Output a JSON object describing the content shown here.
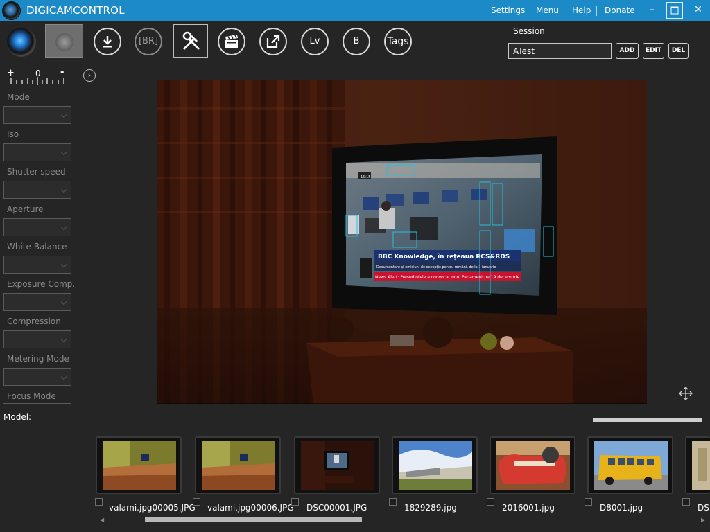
{
  "titlebar": {
    "app_title": "DIGICAMCONTROL",
    "menu": [
      "Settings",
      "Menu",
      "Help",
      "Donate"
    ],
    "min_label": "–",
    "max_label": "▢",
    "close_label": "✕"
  },
  "toolbar": {
    "br_label": "[BR]",
    "lv_label": "Lv",
    "b_label": "B",
    "tags_label": "Tags"
  },
  "session": {
    "label": "Session",
    "value": "ATest",
    "add": "ADD",
    "edit": "EDIT",
    "del": "DEL"
  },
  "left_panel": {
    "ev_plus": "+",
    "ev_zero": "0",
    "ev_minus": "-",
    "fields": [
      {
        "label": "Mode"
      },
      {
        "label": "Iso"
      },
      {
        "label": "Shutter speed"
      },
      {
        "label": "Aperture"
      },
      {
        "label": "White Balance"
      },
      {
        "label": "Exposure Comp."
      },
      {
        "label": "Compression"
      },
      {
        "label": "Metering Mode"
      },
      {
        "label": "Focus Mode"
      }
    ],
    "model_label": "Model:"
  },
  "thumbnails": [
    {
      "name": "valami.jpg00005.JPG"
    },
    {
      "name": "valami.jpg00006.JPG"
    },
    {
      "name": "DSC00001.JPG"
    },
    {
      "name": "1829289.jpg"
    },
    {
      "name": "2016001.jpg"
    },
    {
      "name": "D8001.jpg"
    },
    {
      "name": "DS"
    }
  ],
  "main_image": {
    "overlay_title": "BBC Knowledge, în rețeaua RCS&RDS",
    "overlay_sub": "Documentare și emisiuni de excepție pentru români, de la 1 ianuarie",
    "overlay_news": "News Alert: Președintele a convocat noul Parlament pe 19 decembrie",
    "tv_clock": "15:15"
  }
}
